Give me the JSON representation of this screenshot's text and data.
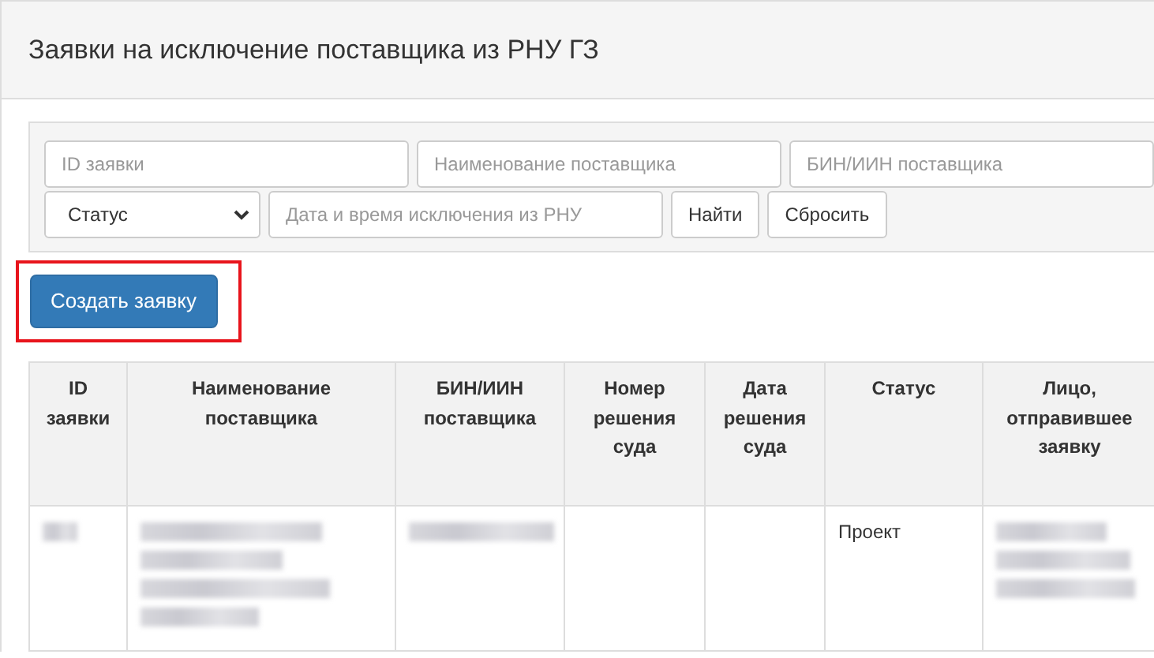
{
  "panel": {
    "title": "Заявки на исключение поставщика из РНУ ГЗ"
  },
  "filters": {
    "fields": [
      {
        "placeholder": "ID заявки"
      },
      {
        "placeholder": "Наименование поставщика"
      },
      {
        "placeholder": "БИН/ИИН поставщика"
      }
    ],
    "status_select": {
      "value": "Статус"
    },
    "date_field": {
      "placeholder": "Дата и время исключения из РНУ"
    },
    "buttons": [
      "Найти",
      "Сбросить"
    ]
  },
  "create_button": {
    "label": "Создать заявку",
    "highlighted": true
  },
  "table": {
    "columns": [
      "ID заявки",
      "Наименование поставщика",
      "БИН/ИИН поставщика",
      "Номер решения суда",
      "Дата решения суда",
      "Статус",
      "Лицо, отправившее заявку"
    ],
    "rows": [
      {
        "cells": [
          {
            "kind": "redacted"
          },
          {
            "kind": "redacted"
          },
          {
            "kind": "redacted"
          },
          {
            "kind": "empty"
          },
          {
            "kind": "empty"
          },
          {
            "kind": "text",
            "text": "Проект"
          },
          {
            "kind": "redacted"
          }
        ]
      }
    ]
  }
}
